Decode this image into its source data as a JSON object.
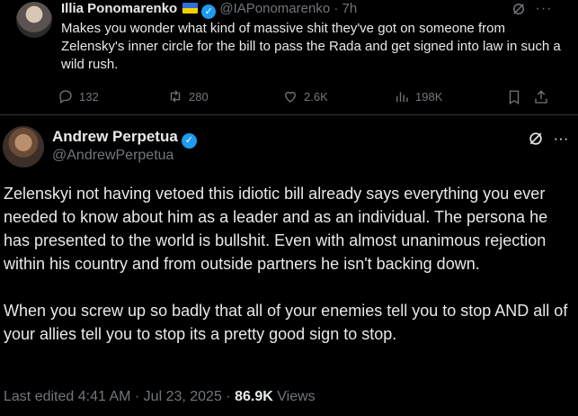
{
  "top_tweet": {
    "author_name": "Illia Ponomarenko",
    "handle": "@IAPonomarenko",
    "separator": "·",
    "time": "7h",
    "text": "Makes you wonder what kind of massive shit they've got on someone from Zelensky's inner circle for the bill to pass the Rada and get signed into law in such a wild rush.",
    "replies": "132",
    "reposts": "280",
    "likes": "2.6K",
    "views": "198K"
  },
  "main_tweet": {
    "author_name": "Andrew Perpetua",
    "handle": "@AndrewPerpetua",
    "paragraph1": "Zelenskyi not having vetoed this idiotic bill already says everything you ever needed to know about him as a leader and as an individual. The persona he has presented to the world is bullshit. Even with almost unanimous rejection within his country and from outside partners he isn't backing down.",
    "paragraph2": "When you screw up so badly that all of your enemies tell you to stop AND all of your allies tell you to stop its a pretty good sign to stop.",
    "edited_label": "Last edited",
    "time": "4:41 AM",
    "dot": "·",
    "date": "Jul 23, 2025",
    "views_count": "86.9K",
    "views_label": "Views"
  },
  "colors": {
    "background": "#000000",
    "text": "#e7e9ea",
    "muted": "#71767b",
    "verified": "#1d9bf0"
  },
  "icons": [
    "grok-icon",
    "more-icon",
    "reply-icon",
    "repost-icon",
    "like-icon",
    "views-icon",
    "bookmark-icon",
    "share-icon",
    "verified-icon",
    "ukraine-flag-icon"
  ]
}
